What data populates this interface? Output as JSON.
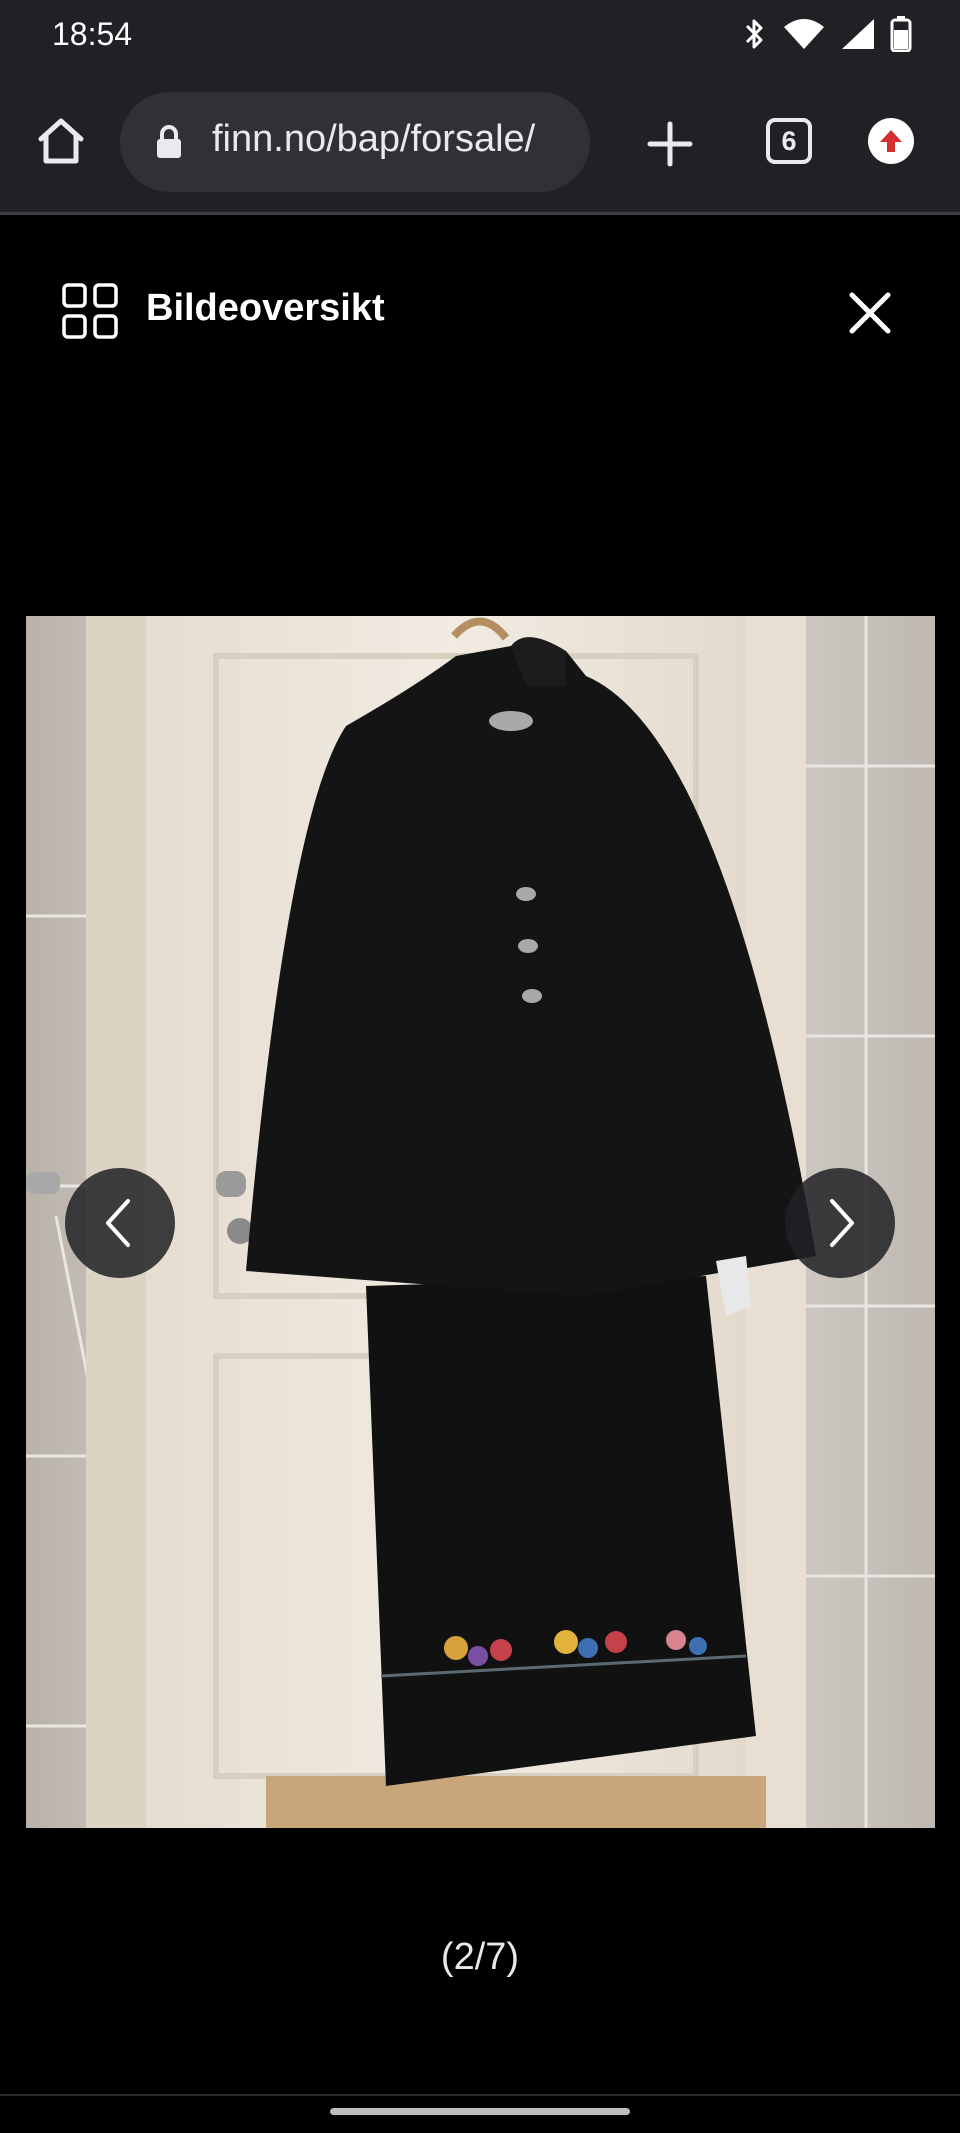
{
  "status_bar": {
    "time": "18:54",
    "icons": [
      "bluetooth-icon",
      "wifi-icon",
      "signal-icon",
      "battery-icon"
    ]
  },
  "browser": {
    "url": "finn.no/bap/forsale/",
    "tab_count": "6",
    "icons": [
      "home-icon",
      "lock-icon",
      "plus-icon",
      "tabs-icon",
      "extension-icon"
    ]
  },
  "gallery": {
    "title": "Bildeoversikt",
    "counter": "(2/7)",
    "icons": [
      "grid-icon",
      "close-icon",
      "chevron-left-icon",
      "chevron-right-icon"
    ]
  },
  "colors": {
    "chrome_bg": "#202124",
    "url_bar_bg": "#303134",
    "page_bg": "#000000",
    "extension_accent": "#d32f2f"
  }
}
